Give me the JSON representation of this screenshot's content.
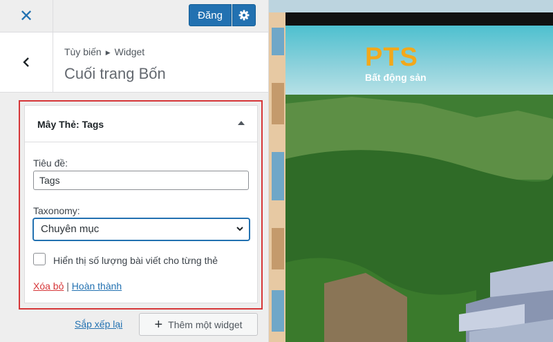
{
  "topbar": {
    "close_icon": "close-icon",
    "publish_label": "Đăng",
    "settings_icon": "gear-icon"
  },
  "header": {
    "breadcrumb_parent": "Tùy biến",
    "breadcrumb_child": "Widget",
    "section_title": "Cuối trang Bốn"
  },
  "widget": {
    "title": "Mây Thẻ: Tags",
    "title_field_label": "Tiêu đề:",
    "title_value": "Tags",
    "taxonomy_label": "Taxonomy:",
    "taxonomy_selected": "Chuyên mục",
    "show_count_label": "Hiển thị số lượng bài viết cho từng thẻ",
    "show_count_checked": false,
    "delete_label": "Xóa bỏ",
    "separator": "|",
    "done_label": "Hoàn thành"
  },
  "footer": {
    "reorder_label": "Sắp xếp lại",
    "add_widget_label": "Thêm một widget"
  },
  "preview": {
    "site_name": "PTS",
    "tagline": "Bất động sản"
  },
  "colors": {
    "accent": "#2271b1",
    "highlight": "#d63638",
    "site_name": "#f2a81b"
  }
}
